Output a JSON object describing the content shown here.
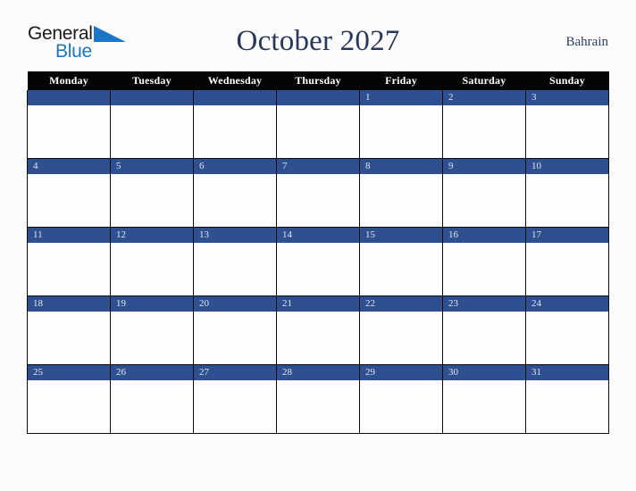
{
  "brand": {
    "word_one": "General",
    "word_two": "Blue",
    "triangle_icon": "triangle-icon",
    "color_dark": "#1a1a1a",
    "color_blue": "#1c76c8"
  },
  "header": {
    "title": "October 2027",
    "country": "Bahrain",
    "title_color": "#28385c",
    "country_color": "#2c3e63"
  },
  "calendar": {
    "weekday_headers": [
      "Monday",
      "Tuesday",
      "Wednesday",
      "Thursday",
      "Friday",
      "Saturday",
      "Sunday"
    ],
    "header_bg": "#050505",
    "header_text_color": "#ffffff",
    "date_bar_color": "#2e5090",
    "date_text_color": "#e2e6ef",
    "cell_bg": "#fdfdfe",
    "grid_line_color": "#0b0b0b",
    "weeks": [
      [
        "",
        "",
        "",
        "",
        "1",
        "2",
        "3"
      ],
      [
        "4",
        "5",
        "6",
        "7",
        "8",
        "9",
        "10"
      ],
      [
        "11",
        "12",
        "13",
        "14",
        "15",
        "16",
        "17"
      ],
      [
        "18",
        "19",
        "20",
        "21",
        "22",
        "23",
        "24"
      ],
      [
        "25",
        "26",
        "27",
        "28",
        "29",
        "30",
        "31"
      ]
    ]
  }
}
